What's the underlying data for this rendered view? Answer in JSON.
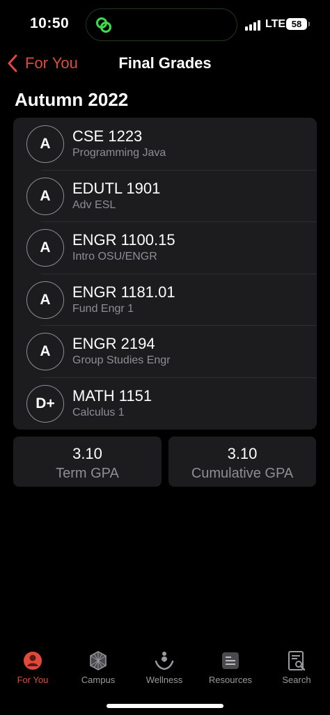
{
  "status_bar": {
    "time": "10:50",
    "network": "LTE",
    "battery": "58"
  },
  "nav": {
    "back_label": "For You",
    "title": "Final Grades"
  },
  "term": {
    "title": "Autumn 2022"
  },
  "courses": [
    {
      "grade": "A",
      "code": "CSE 1223",
      "name": "Programming Java"
    },
    {
      "grade": "A",
      "code": "EDUTL 1901",
      "name": "Adv ESL"
    },
    {
      "grade": "A",
      "code": "ENGR 1100.15",
      "name": "Intro OSU/ENGR"
    },
    {
      "grade": "A",
      "code": "ENGR 1181.01",
      "name": "Fund Engr 1"
    },
    {
      "grade": "A",
      "code": "ENGR 2194",
      "name": "Group Studies Engr"
    },
    {
      "grade": "D+",
      "code": "MATH 1151",
      "name": "Calculus 1"
    }
  ],
  "gpa": {
    "term": {
      "value": "3.10",
      "label": "Term GPA"
    },
    "cumulative": {
      "value": "3.10",
      "label": "Cumulative GPA"
    }
  },
  "tabs": [
    {
      "label": "For You",
      "icon": "person-icon",
      "active": true
    },
    {
      "label": "Campus",
      "icon": "campus-icon",
      "active": false
    },
    {
      "label": "Wellness",
      "icon": "wellness-icon",
      "active": false
    },
    {
      "label": "Resources",
      "icon": "resources-icon",
      "active": false
    },
    {
      "label": "Search",
      "icon": "search-icon",
      "active": false
    }
  ],
  "colors": {
    "accent": "#e2493b",
    "background": "#000000",
    "card": "#1c1c1e",
    "secondary_text": "#8e8e93"
  }
}
